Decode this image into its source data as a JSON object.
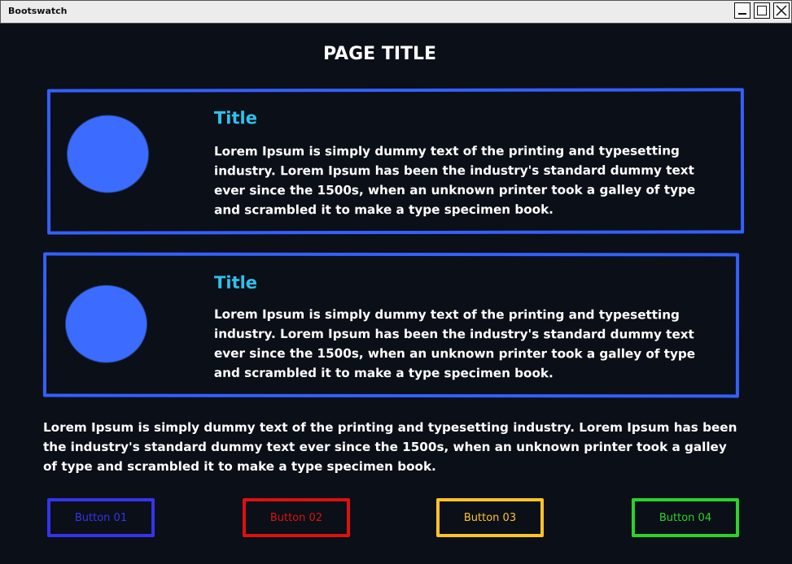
{
  "window": {
    "title": "Bootswatch"
  },
  "page": {
    "title": "PAGE TITLE"
  },
  "cards": [
    {
      "title": "Title",
      "body": "Lorem Ipsum is simply dummy text of the printing and typesetting industry. Lorem Ipsum has been the industry's standard dummy text ever since the 1500s, when an unknown printer took a galley of type and scrambled it to make a type specimen book."
    },
    {
      "title": "Title",
      "body": "Lorem Ipsum is simply dummy text of the printing and typesetting industry. Lorem Ipsum has been the industry's standard dummy text ever since the 1500s, when an unknown printer took a galley of type and scrambled it to make a type specimen book."
    }
  ],
  "paragraph": "Lorem Ipsum is simply dummy text of the printing and typesetting industry. Lorem Ipsum has been the industry's standard dummy text ever since the 1500s, when an unknown printer took a galley of type and scrambled it to make a type specimen book.",
  "buttons": [
    {
      "label": "Button 01",
      "color": "#3434ee"
    },
    {
      "label": "Button 02",
      "color": "#dd1111"
    },
    {
      "label": "Button 03",
      "color": "#ffc22a"
    },
    {
      "label": "Button 04",
      "color": "#2bd22b"
    }
  ],
  "colors": {
    "background": "#0b0f17",
    "card_border": "#3460ff",
    "card_title": "#2fc1ef",
    "avatar_fill": "#3b6cff"
  }
}
